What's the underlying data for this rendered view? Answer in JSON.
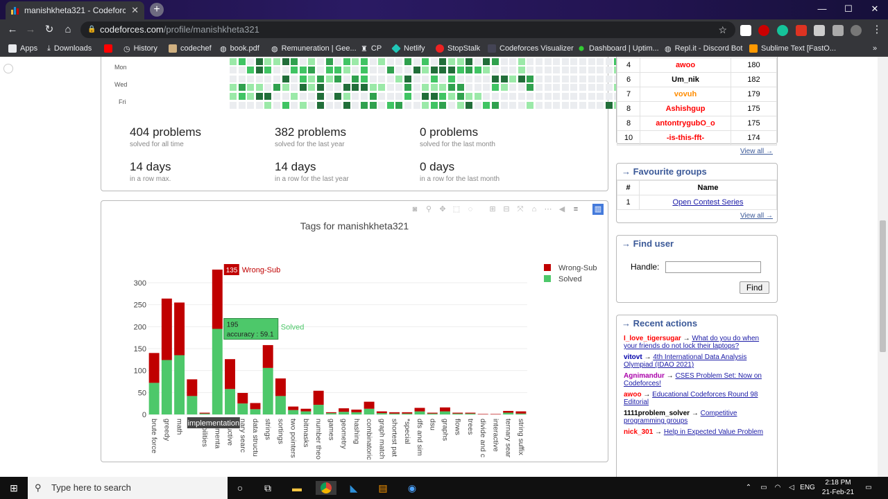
{
  "browser": {
    "tab_title": "manishkheta321 - Codeforces",
    "url_host": "codeforces.com",
    "url_path": "/profile/manishkheta321"
  },
  "bookmarks": [
    "Apps",
    "Downloads",
    "",
    "History",
    "codechef",
    "book.pdf",
    "Remuneration | Gee...",
    "CP",
    "Netlify",
    "StopStalk",
    "Codeforces Visualizer",
    "Dashboard | Uptim...",
    "Repl.it - Discord Bot",
    "Sublime Text [FastO..."
  ],
  "heatmap": {
    "days": [
      "Mon",
      "Wed",
      "Fri"
    ]
  },
  "stats": [
    {
      "n": "404 problems",
      "d": "solved for all time"
    },
    {
      "n": "382 problems",
      "d": "solved for the last year"
    },
    {
      "n": "0 problems",
      "d": "solved for the last month"
    },
    {
      "n": "14 days",
      "d": "in a row max."
    },
    {
      "n": "14 days",
      "d": "in a row for the last year"
    },
    {
      "n": "0 days",
      "d": "in a row for the last month"
    }
  ],
  "chart_data": {
    "type": "bar",
    "title": "Tags for manishkheta321",
    "stacked": true,
    "legend_position": "top-right",
    "ylim": [
      0,
      330
    ],
    "yticks": [
      0,
      50,
      100,
      150,
      200,
      250,
      300
    ],
    "categories": [
      "brute force",
      "greedy",
      "math",
      "",
      "probabilities",
      "implementation",
      "constructive",
      "binary search",
      "data structures",
      "strings",
      "sortings",
      "two pointers",
      "bitmasks",
      "number theory",
      "games",
      "geometry",
      "hashing",
      "combinatorics",
      "graph matchings",
      "shortest paths",
      "*special",
      "dfs and similar",
      "dsu",
      "graphs",
      "flows",
      "trees",
      "divide and conquer",
      "interactive",
      "ternary search",
      "string suffix"
    ],
    "tick_labels": [
      "brute force",
      "greedy",
      "math",
      "",
      "babilities",
      "plementa",
      "structive",
      "nary searc",
      "data structu",
      "strings",
      "sortings",
      "two pointers",
      "bitmasks",
      "number theo",
      "games",
      "geometry",
      "hashing",
      "combinatoric",
      "graph match",
      "shortest pat",
      "*special",
      "dfs and sim",
      "dsu",
      "graphs",
      "flows",
      "trees",
      "divide and c",
      "interactive",
      "ternary sear",
      "string suffix"
    ],
    "series": [
      {
        "name": "Solved",
        "color": "#4dc86a",
        "values": [
          72,
          124,
          135,
          42,
          2,
          195,
          58,
          25,
          12,
          106,
          42,
          10,
          7,
          22,
          3,
          6,
          5,
          13,
          3,
          2,
          2,
          7,
          2,
          7,
          2,
          2,
          0,
          0,
          4,
          2
        ]
      },
      {
        "name": "Wrong-Sub",
        "color": "#c00000",
        "values": [
          68,
          140,
          120,
          38,
          2,
          135,
          68,
          24,
          14,
          52,
          40,
          8,
          6,
          32,
          2,
          8,
          6,
          16,
          4,
          3,
          3,
          8,
          2,
          9,
          2,
          2,
          1,
          1,
          4,
          5
        ]
      }
    ],
    "hover": {
      "category": "implementation",
      "wrong_label": "135",
      "wrong_name": "Wrong-Sub",
      "solved_line1": "195",
      "solved_line2": "accuracy : 59.1",
      "solved_name": "Solved"
    }
  },
  "rating": {
    "rows": [
      {
        "rank": "4",
        "name": "awoo",
        "val": "180",
        "color": "#ff0000"
      },
      {
        "rank": "6",
        "name": "Um_nik",
        "val": "182",
        "color": "#000000"
      },
      {
        "rank": "7",
        "name": "vovuh",
        "val": "179",
        "color": "#ff8c00"
      },
      {
        "rank": "8",
        "name": "Ashishgup",
        "val": "175",
        "color": "#ff0000"
      },
      {
        "rank": "8",
        "name": "antontrygubO_o",
        "val": "175",
        "color": "#ff0000"
      },
      {
        "rank": "10",
        "name": "-is-this-fft-",
        "val": "174",
        "color": "#ff0000"
      }
    ],
    "view_all": "View all →"
  },
  "groups": {
    "title": "→ Favourite groups",
    "col1": "#",
    "col2": "Name",
    "rows": [
      {
        "n": "1",
        "name": "Open Contest Series"
      }
    ],
    "view_all": "View all →"
  },
  "find": {
    "title": "→ Find user",
    "label": "Handle:",
    "button": "Find"
  },
  "recent": {
    "title": "→ Recent actions",
    "items": [
      {
        "user": "I_love_tigersugar",
        "ucolor": "#ff0000",
        "text": "What do you do when your friends do not lock their laptops?"
      },
      {
        "user": "vitovt",
        "ucolor": "#0000aa",
        "text": "4th International Data Analysis Olympiad (IDAO 2021)"
      },
      {
        "user": "Agnimandur",
        "ucolor": "#aa00aa",
        "text": "CSES Problem Set: Now on Codeforces!"
      },
      {
        "user": "awoo",
        "ucolor": "#ff0000",
        "text": "Educational Codeforces Round 98 Editorial"
      },
      {
        "user": "1111problem_solver",
        "ucolor": "#000000",
        "text": "Competitive programming groups"
      },
      {
        "user": "nick_301",
        "ucolor": "#ff0000",
        "text": "Help in Expected Value Problem"
      }
    ]
  },
  "taskbar": {
    "search": "Type here to search",
    "time": "2:18 PM",
    "date": "21-Feb-21",
    "lang": "ENG"
  }
}
